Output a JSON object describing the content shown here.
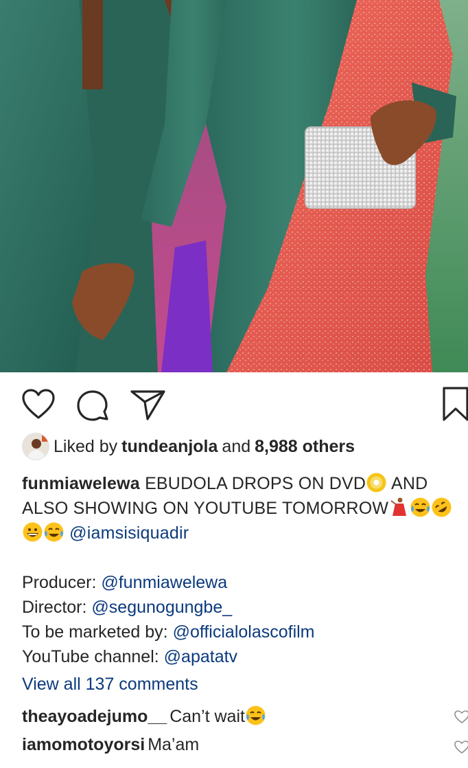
{
  "post": {
    "image": {
      "description_icon": "photo"
    },
    "actions": {
      "like_icon": "heart-outline-icon",
      "comment_icon": "comment-bubble-icon",
      "share_icon": "paper-plane-icon",
      "save_icon": "bookmark-icon"
    },
    "likes": {
      "prefix": "Liked by",
      "user": "tundeanjola",
      "joiner": "and",
      "others": "8,988 others"
    },
    "caption": {
      "username": "funmiawelewa",
      "text_1": "EBUDOLA DROPS ON DVD",
      "text_2": "AND ALSO SHOWING ON YOUTUBE TOMORROW",
      "mention": "@iamsisiquadir",
      "credits": [
        {
          "label": "Producer:",
          "value": "@funmiawelewa"
        },
        {
          "label": "Director:",
          "value": "@segunogungbe_"
        },
        {
          "label": "To be marketed by:",
          "value": "@officialolascofilm"
        },
        {
          "label": "YouTube channel:",
          "value": "@apatatv"
        }
      ]
    },
    "view_all_comments": "View all 137 comments",
    "comments": [
      {
        "user": "theayoadejumo__",
        "text": "Can’t wait"
      },
      {
        "user": "iamomotoyorsi",
        "text": "Ma’am"
      }
    ]
  },
  "colors": {
    "text": "#262626",
    "link": "#0b3a7e",
    "fabric_green": "#2f6e60",
    "coral": "#e35b4f"
  }
}
